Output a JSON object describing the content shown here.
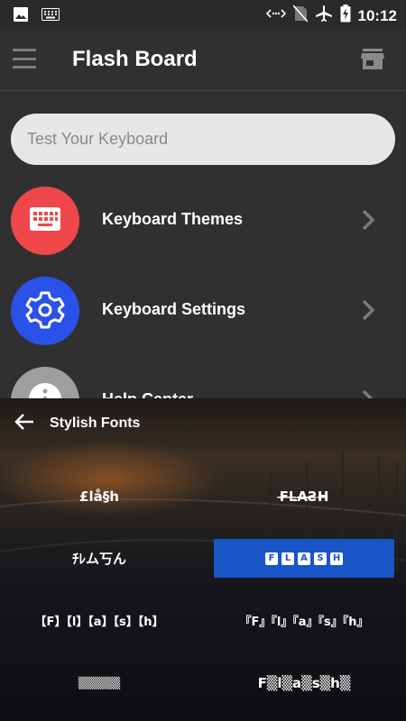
{
  "status_bar": {
    "time": "10:12",
    "icons_left": [
      "image-icon",
      "keyboard-icon"
    ],
    "icons_right": [
      "data-saver-icon",
      "no-sim-icon",
      "airplane-icon",
      "battery-charging-icon"
    ]
  },
  "app_bar": {
    "title": "Flash Board",
    "menu_icon": "hamburger-icon",
    "action_icon": "store-icon"
  },
  "search": {
    "placeholder": "Test Your Keyboard"
  },
  "menu": {
    "items": [
      {
        "label": "Keyboard Themes",
        "icon": "keyboard-icon",
        "color": "#f0474a"
      },
      {
        "label": "Keyboard Settings",
        "icon": "gear-icon",
        "color": "#2a52e8"
      },
      {
        "label": "Help Center",
        "icon": "info-icon",
        "color": "#9e9e9e"
      }
    ]
  },
  "stylish_fonts": {
    "title": "Stylish Fonts",
    "options": [
      {
        "label": "£lå§h",
        "selected": false
      },
      {
        "label": "F̶L̶A̶Ƨ̶H̶",
        "selected": false
      },
      {
        "label": "ﾁﾚム丂ん",
        "selected": false
      },
      {
        "label": "FLASH",
        "letters": [
          "F",
          "L",
          "A",
          "S",
          "H"
        ],
        "selected": true
      },
      {
        "label": "【F】【l】【a】【s】【h】",
        "selected": false
      },
      {
        "label": "『F』『l』『a』『s』『h』",
        "selected": false
      },
      {
        "label": "▒▒▒▒▒",
        "selected": false
      },
      {
        "label": "F▒l▒a▒s▒h▒",
        "selected": false
      }
    ]
  },
  "colors": {
    "background": "#303030",
    "selected_font": "#1a55c8",
    "search_bg": "#e6e6e6"
  }
}
